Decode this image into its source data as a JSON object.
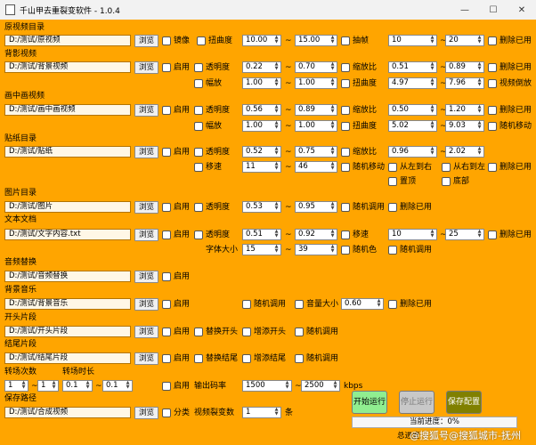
{
  "window": {
    "title": "千山甲去重裂变软件 - 1.0.4",
    "min": "—",
    "max": "☐",
    "close": "✕"
  },
  "labels": {
    "source_dir": "原视频目录",
    "bg_video": "背影视频",
    "pip_video": "画中画视频",
    "sticker_dir": "贴纸目录",
    "image_dir": "图片目录",
    "text_doc": "文本文档",
    "audio_replace": "音频替换",
    "bg_music": "背景音乐",
    "intro": "开头片段",
    "outro": "结尾片段",
    "transition_count": "转场次数",
    "transition_duration": "转场时长",
    "save_path": "保存路径"
  },
  "browse_label": "浏览",
  "tilde": "~",
  "row_source": {
    "path": "D:/测试/原视频",
    "mirror": "镜像",
    "distort": "扭曲度",
    "distort_min": "10.00",
    "distort_max": "15.00",
    "drop_frame": "抽帧",
    "drop_min": "10",
    "drop_max": "20",
    "delete_used": "删除已用"
  },
  "row_bg": {
    "path": "D:/测试/背景视频",
    "enable": "启用",
    "opacity": "透明度",
    "opacity_min": "0.22",
    "opacity_max": "0.70",
    "scale": "缩放比",
    "scale_min": "0.51",
    "scale_max": "0.89",
    "delete_used": "删除已用",
    "amplitude": "幅放",
    "amp_min": "1.00",
    "amp_max": "1.00",
    "distort": "扭曲度",
    "distort_min": "4.97",
    "distort_max": "7.96",
    "reverse": "视频倒放"
  },
  "row_pip": {
    "path": "D:/测试/画中画视频",
    "enable": "启用",
    "opacity": "透明度",
    "opacity_min": "0.56",
    "opacity_max": "0.89",
    "scale": "缩放比",
    "scale_min": "0.50",
    "scale_max": "1.20",
    "delete_used": "删除已用",
    "amplitude": "幅放",
    "amp_min": "1.00",
    "amp_max": "1.00",
    "distort": "扭曲度",
    "distort_min": "5.02",
    "distort_max": "9.03",
    "random_move": "随机移动"
  },
  "row_sticker": {
    "path": "D:/测试/贴纸",
    "enable": "启用",
    "opacity": "透明度",
    "opacity_min": "0.52",
    "opacity_max": "0.75",
    "scale": "缩放比",
    "scale_min": "0.96",
    "scale_max": "2.02",
    "move_speed": "移速",
    "speed_min": "11",
    "speed_max": "46",
    "random_move": "随机移动",
    "left_to_right": "从左到右",
    "right_to_left": "从右到左",
    "delete_used": "删除已用",
    "top": "置顶",
    "bottom": "底部"
  },
  "row_image": {
    "path": "D:/测试/图片",
    "enable": "启用",
    "opacity": "透明度",
    "opacity_min": "0.53",
    "opacity_max": "0.95",
    "random_pick": "随机调用",
    "delete_used": "删除已用"
  },
  "row_text": {
    "path": "D:/测试/文字内容.txt",
    "enable": "启用",
    "opacity": "透明度",
    "opacity_min": "0.51",
    "opacity_max": "0.92",
    "move_speed": "移速",
    "speed_min": "10",
    "speed_max": "25",
    "delete_used": "删除已用",
    "font_size": "字体大小",
    "font_min": "15",
    "font_max": "39",
    "random_color": "随机色",
    "random_pick": "随机调用"
  },
  "row_audio": {
    "path": "D:/测试/音频替换",
    "enable": "启用"
  },
  "row_music": {
    "path": "D:/测试/背景音乐",
    "enable": "启用",
    "random_pick": "随机调用",
    "volume": "音量大小",
    "volume_value": "0.60",
    "delete_used": "删除已用"
  },
  "row_intro": {
    "path": "D:/测试/开头片段",
    "enable": "启用",
    "replace": "替换开头",
    "add": "增添开头",
    "random_pick": "随机调用"
  },
  "row_outro": {
    "path": "D:/测试/结尾片段",
    "enable": "启用",
    "replace": "替换结尾",
    "add": "增添结尾",
    "random_pick": "随机调用"
  },
  "row_transition": {
    "count_min": "1",
    "count_max": "1",
    "dur_min": "0.1",
    "dur_max": "0.1",
    "enable": "启用",
    "bitrate": "输出码率",
    "bitrate_min": "1500",
    "bitrate_max": "2500",
    "bitrate_unit": "kbps"
  },
  "row_save": {
    "path": "D:/测试/合成视频",
    "classify": "分类",
    "split": "视频裂变数",
    "split_value": "1",
    "split_unit": "条"
  },
  "actions": {
    "start": "开始运行",
    "stop": "停止运行",
    "save": "保存配置"
  },
  "progress": {
    "current_label": "当前进度：0%",
    "current_value": 0,
    "total_label": "总进度"
  },
  "watermark": "@搜狐号@搜狐城市-抚州",
  "colors": {
    "background": "#ffa500",
    "start": "#90ee90",
    "stop": "#c8c8c8",
    "save": "#808000"
  }
}
